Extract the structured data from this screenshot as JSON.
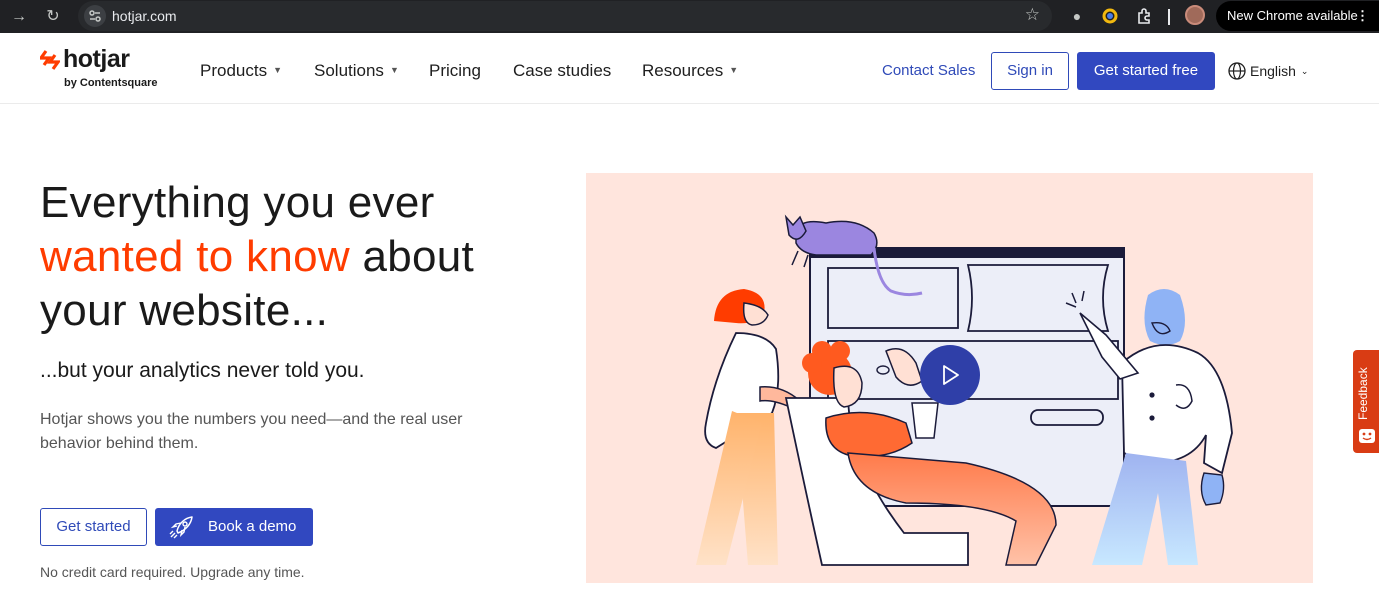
{
  "browser": {
    "url": "hotjar.com",
    "update_label": "New Chrome available",
    "menu_glyph": "⋮"
  },
  "header": {
    "logo_word": "hotjar",
    "logo_sub": "by Contentsquare",
    "nav": [
      {
        "label": "Products",
        "has_menu": true
      },
      {
        "label": "Solutions",
        "has_menu": true
      },
      {
        "label": "Pricing",
        "has_menu": false
      },
      {
        "label": "Case studies",
        "has_menu": false
      },
      {
        "label": "Resources",
        "has_menu": true
      }
    ],
    "contact_sales": "Contact Sales",
    "sign_in": "Sign in",
    "get_started_free": "Get started free",
    "language": "English"
  },
  "hero": {
    "title_line1": "Everything you ever",
    "title_accent": "wanted to know",
    "title_after_accent": " about",
    "title_line3": "your website...",
    "tagline": "...but your analytics never told you.",
    "description": "Hotjar shows you the numbers you need—and the real user behavior behind them.",
    "cta_primary": "Get started",
    "cta_secondary": "Book a demo",
    "note": "No credit card required. Upgrade any time."
  },
  "feedback_tab": "Feedback",
  "colors": {
    "brand_blue": "#3148c0",
    "accent_orange": "#ff3c00",
    "illustration_bg": "#ffe5dd",
    "feedback_red": "#d93c14"
  }
}
